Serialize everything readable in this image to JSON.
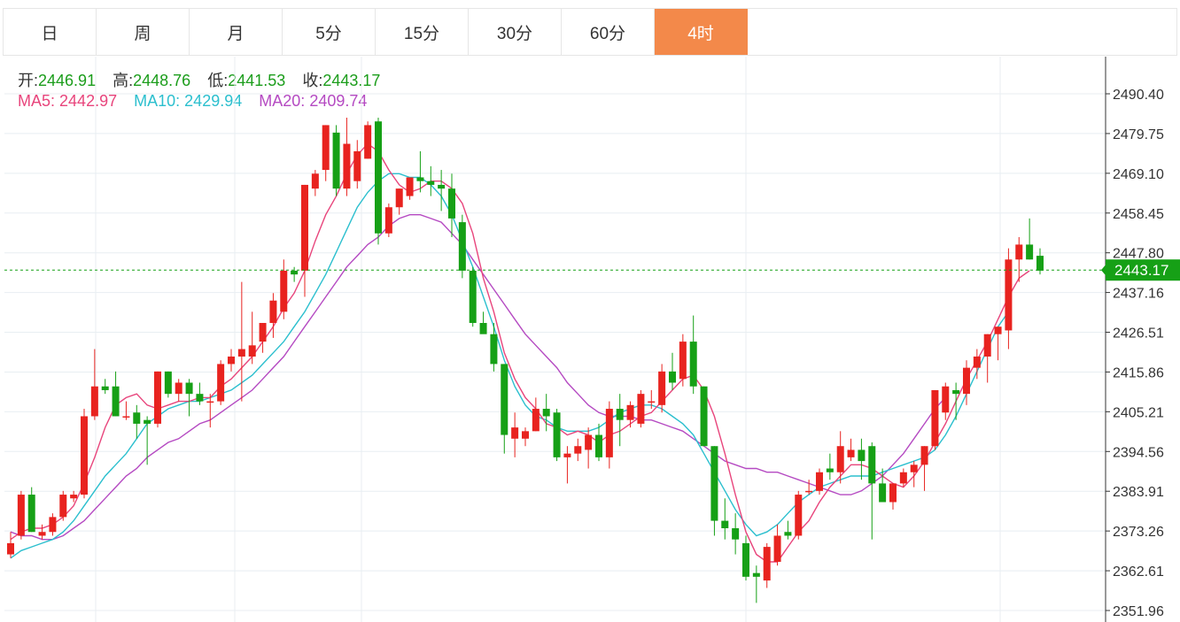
{
  "tabs": [
    {
      "label": "日"
    },
    {
      "label": "周"
    },
    {
      "label": "月"
    },
    {
      "label": "5分"
    },
    {
      "label": "15分"
    },
    {
      "label": "30分"
    },
    {
      "label": "60分"
    },
    {
      "label": "4时"
    }
  ],
  "active_tab": 7,
  "ohlc": {
    "open_label": "开:",
    "open": "2446.91",
    "high_label": "高:",
    "high": "2448.76",
    "low_label": "低:",
    "low": "2441.53",
    "close_label": "收:",
    "close": "2443.17"
  },
  "ma": {
    "ma5_label": "MA5:",
    "ma5": "2442.97",
    "ma10_label": "MA10:",
    "ma10": "2429.94",
    "ma20_label": "MA20:",
    "ma20": "2409.74"
  },
  "colors": {
    "up": "#e8231f",
    "down": "#16a016",
    "ma5": "#e8457c",
    "ma10": "#2bbfce",
    "ma20": "#b54ac2",
    "tab_active": "#f3894a",
    "grid": "#e8eef2"
  },
  "chart_data": {
    "type": "candlestick",
    "ylim": [
      2351.96,
      2495.0
    ],
    "y_ticks": [
      "2490.40",
      "2479.75",
      "2469.10",
      "2458.45",
      "2447.80",
      "2437.16",
      "2426.51",
      "2415.86",
      "2405.21",
      "2394.56",
      "2383.91",
      "2373.26",
      "2362.61",
      "2351.96"
    ],
    "last_price": "2443.17",
    "candles": [
      [
        2367,
        2373,
        2366,
        2370
      ],
      [
        2372,
        2384,
        2371,
        2383
      ],
      [
        2383,
        2385,
        2373,
        2373
      ],
      [
        2372,
        2375,
        2371,
        2373
      ],
      [
        2373,
        2378,
        2372,
        2377
      ],
      [
        2377,
        2384,
        2376,
        2383
      ],
      [
        2382,
        2384,
        2381,
        2383
      ],
      [
        2383,
        2406,
        2382,
        2404
      ],
      [
        2404,
        2422,
        2403,
        2412
      ],
      [
        2412,
        2414,
        2410,
        2411
      ],
      [
        2412,
        2416,
        2404,
        2404
      ],
      [
        2404,
        2408,
        2403,
        2404
      ],
      [
        2405,
        2407,
        2398,
        2402
      ],
      [
        2403,
        2404,
        2391,
        2402
      ],
      [
        2402,
        2416,
        2401,
        2416
      ],
      [
        2416,
        2416,
        2409,
        2410
      ],
      [
        2410,
        2414,
        2408,
        2413
      ],
      [
        2413,
        2414,
        2404,
        2410
      ],
      [
        2410,
        2413,
        2407,
        2408
      ],
      [
        2408,
        2410,
        2401,
        2408
      ],
      [
        2408,
        2419,
        2407,
        2418
      ],
      [
        2418,
        2422,
        2416,
        2420
      ],
      [
        2420,
        2440,
        2408,
        2422
      ],
      [
        2420,
        2432,
        2418,
        2423
      ],
      [
        2424,
        2429,
        2421,
        2429
      ],
      [
        2429,
        2437,
        2425,
        2435
      ],
      [
        2432,
        2446,
        2430,
        2443
      ],
      [
        2443,
        2444,
        2440,
        2442
      ],
      [
        2443,
        2466,
        2436,
        2466
      ],
      [
        2465,
        2470,
        2463,
        2469
      ],
      [
        2470,
        2482,
        2467,
        2482
      ],
      [
        2480,
        2482,
        2463,
        2465
      ],
      [
        2465,
        2484,
        2463,
        2477
      ],
      [
        2467,
        2478,
        2465,
        2475
      ],
      [
        2473,
        2483,
        2473,
        2482
      ],
      [
        2483,
        2484,
        2450,
        2453
      ],
      [
        2453,
        2461,
        2452,
        2460
      ],
      [
        2460,
        2465,
        2458,
        2465
      ],
      [
        2463,
        2468,
        2462,
        2468
      ],
      [
        2468,
        2475,
        2464,
        2467
      ],
      [
        2467,
        2471,
        2463,
        2466
      ],
      [
        2466,
        2470,
        2459,
        2465
      ],
      [
        2465,
        2469,
        2452,
        2457
      ],
      [
        2456,
        2458,
        2441,
        2443
      ],
      [
        2443,
        2444,
        2428,
        2429
      ],
      [
        2429,
        2432,
        2427,
        2426
      ],
      [
        2426,
        2429,
        2416,
        2418
      ],
      [
        2418,
        2418,
        2394,
        2399
      ],
      [
        2398,
        2405,
        2393,
        2401
      ],
      [
        2398,
        2401,
        2396,
        2400
      ],
      [
        2400,
        2409,
        2400,
        2406
      ],
      [
        2406,
        2410,
        2400,
        2404
      ],
      [
        2405,
        2406,
        2392,
        2393
      ],
      [
        2393,
        2396,
        2386,
        2394
      ],
      [
        2394,
        2398,
        2392,
        2396
      ],
      [
        2395,
        2401,
        2390,
        2399
      ],
      [
        2399,
        2402,
        2392,
        2393
      ],
      [
        2393,
        2408,
        2390,
        2406
      ],
      [
        2406,
        2410,
        2396,
        2403
      ],
      [
        2403,
        2408,
        2401,
        2407
      ],
      [
        2402,
        2411,
        2401,
        2410
      ],
      [
        2408,
        2411,
        2406,
        2408
      ],
      [
        2407,
        2418,
        2405,
        2416
      ],
      [
        2416,
        2421,
        2411,
        2413
      ],
      [
        2414,
        2426,
        2412,
        2424
      ],
      [
        2424,
        2431,
        2410,
        2412
      ],
      [
        2412,
        2412,
        2396,
        2396
      ],
      [
        2396,
        2396,
        2372,
        2376
      ],
      [
        2376,
        2382,
        2371,
        2374
      ],
      [
        2374,
        2378,
        2367,
        2371
      ],
      [
        2370,
        2372,
        2360,
        2361
      ],
      [
        2362,
        2364,
        2354,
        2361
      ],
      [
        2360,
        2370,
        2358,
        2369
      ],
      [
        2365,
        2375,
        2364,
        2372
      ],
      [
        2373,
        2376,
        2371,
        2372
      ],
      [
        2372,
        2384,
        2371,
        2383
      ],
      [
        2384,
        2387,
        2383,
        2384
      ],
      [
        2384,
        2390,
        2383,
        2389
      ],
      [
        2390,
        2394,
        2387,
        2389
      ],
      [
        2389,
        2400,
        2386,
        2396
      ],
      [
        2393,
        2398,
        2392,
        2395
      ],
      [
        2395,
        2398,
        2387,
        2392
      ],
      [
        2396,
        2397,
        2371,
        2386
      ],
      [
        2386,
        2390,
        2381,
        2381
      ],
      [
        2381,
        2385,
        2379,
        2386
      ],
      [
        2386,
        2390,
        2385,
        2389
      ],
      [
        2389,
        2392,
        2385,
        2391
      ],
      [
        2391,
        2396,
        2384,
        2396
      ],
      [
        2396,
        2411,
        2395,
        2411
      ],
      [
        2405,
        2413,
        2403,
        2412
      ],
      [
        2411,
        2413,
        2403,
        2410
      ],
      [
        2410,
        2419,
        2407,
        2417
      ],
      [
        2417,
        2422,
        2414,
        2420
      ],
      [
        2420,
        2426,
        2413,
        2426
      ],
      [
        2426,
        2428,
        2419,
        2428
      ],
      [
        2427,
        2449,
        2422,
        2446
      ],
      [
        2446,
        2452,
        2440,
        2450
      ],
      [
        2450,
        2457,
        2446,
        2446
      ],
      [
        2447,
        2449,
        2442,
        2443
      ]
    ],
    "ma5": [
      2371,
      2373,
      2374,
      2374,
      2375,
      2377,
      2380,
      2386,
      2393,
      2401,
      2407,
      2409,
      2410,
      2407,
      2406,
      2407,
      2408,
      2408,
      2409,
      2409,
      2412,
      2414,
      2417,
      2420,
      2424,
      2428,
      2433,
      2437,
      2443,
      2451,
      2458,
      2463,
      2469,
      2474,
      2477,
      2475,
      2470,
      2466,
      2464,
      2465,
      2467,
      2467,
      2465,
      2461,
      2453,
      2441,
      2432,
      2421,
      2414,
      2409,
      2406,
      2402,
      2401,
      2399,
      2400,
      2399,
      2397,
      2399,
      2400,
      2402,
      2404,
      2405,
      2408,
      2411,
      2414,
      2415,
      2411,
      2404,
      2394,
      2383,
      2373,
      2367,
      2365,
      2365,
      2369,
      2373,
      2376,
      2381,
      2385,
      2388,
      2391,
      2391,
      2390,
      2388,
      2386,
      2385,
      2388,
      2392,
      2397,
      2402,
      2408,
      2414,
      2419,
      2424,
      2430,
      2436,
      2441,
      2443
    ],
    "ma10": [
      2366,
      2368,
      2369,
      2370,
      2371,
      2373,
      2376,
      2380,
      2384,
      2388,
      2391,
      2394,
      2398,
      2402,
      2404,
      2406,
      2407,
      2408,
      2408,
      2409,
      2410,
      2411,
      2413,
      2415,
      2418,
      2421,
      2424,
      2428,
      2432,
      2437,
      2442,
      2448,
      2454,
      2460,
      2464,
      2467,
      2469,
      2469,
      2468,
      2468,
      2466,
      2463,
      2458,
      2451,
      2444,
      2436,
      2428,
      2419,
      2412,
      2407,
      2404,
      2403,
      2401,
      2400,
      2400,
      2400,
      2401,
      2403,
      2405,
      2406,
      2407,
      2407,
      2406,
      2404,
      2402,
      2399,
      2394,
      2389,
      2384,
      2379,
      2375,
      2372,
      2373,
      2375,
      2378,
      2381,
      2383,
      2385,
      2386,
      2387,
      2388,
      2388,
      2388,
      2389,
      2390,
      2391,
      2392,
      2393,
      2395,
      2399,
      2404,
      2410,
      2416,
      2422,
      2428,
      2432
    ],
    "ma20": [
      2373,
      2372,
      2372,
      2371,
      2371,
      2372,
      2374,
      2376,
      2379,
      2382,
      2385,
      2388,
      2390,
      2393,
      2395,
      2397,
      2398,
      2400,
      2402,
      2403,
      2405,
      2407,
      2409,
      2411,
      2414,
      2417,
      2420,
      2424,
      2428,
      2432,
      2436,
      2440,
      2444,
      2447,
      2450,
      2452,
      2455,
      2457,
      2458,
      2458,
      2457,
      2456,
      2453,
      2450,
      2446,
      2442,
      2438,
      2434,
      2430,
      2426,
      2423,
      2420,
      2417,
      2413,
      2410,
      2407,
      2405,
      2404,
      2404,
      2404,
      2403,
      2403,
      2402,
      2401,
      2400,
      2398,
      2396,
      2394,
      2392,
      2391,
      2390,
      2390,
      2389,
      2389,
      2388,
      2387,
      2386,
      2385,
      2384,
      2383,
      2383,
      2384,
      2386,
      2388,
      2391,
      2394,
      2398,
      2402,
      2406,
      2409
    ]
  }
}
